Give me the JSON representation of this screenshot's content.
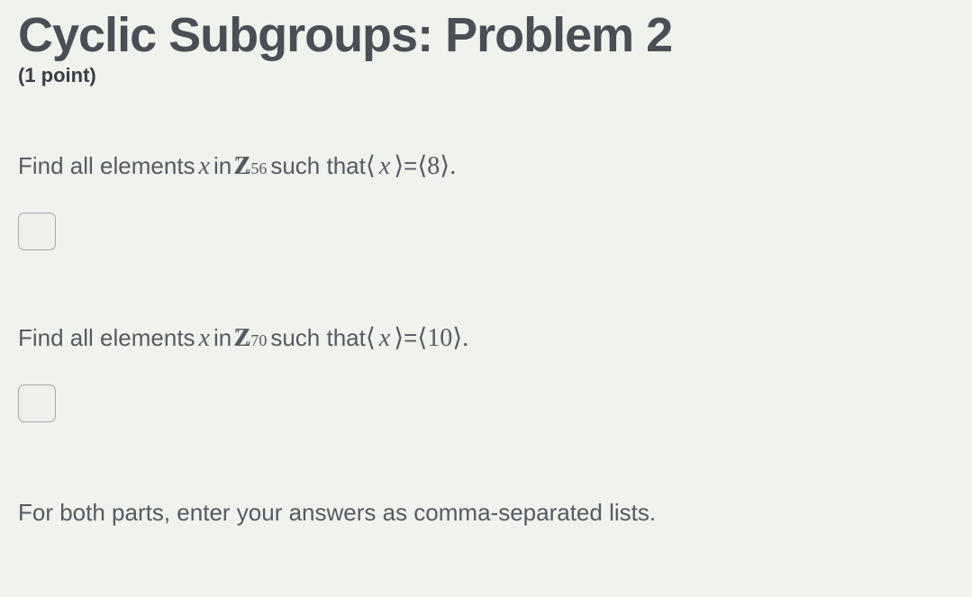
{
  "header": {
    "title": "Cyclic Subgroups: Problem 2",
    "points": "(1 point)"
  },
  "question1": {
    "prefix": "Find all elements ",
    "var": "x",
    "mid": " in ",
    "group_symbol": "Z",
    "group_sub": "56",
    "suffix1": " such that ",
    "angle_open": "⟨",
    "angle_var": "x",
    "angle_close": "⟩",
    "equals": " = ",
    "gen_open": "⟨",
    "gen_val": "8",
    "gen_close": "⟩.",
    "input_value": ""
  },
  "question2": {
    "prefix": "Find all elements ",
    "var": "x",
    "mid": " in ",
    "group_symbol": "Z",
    "group_sub": "70",
    "suffix1": " such that ",
    "angle_open": "⟨",
    "angle_var": "x",
    "angle_close": "⟩",
    "equals": " = ",
    "gen_open": "⟨",
    "gen_val": "10",
    "gen_close": "⟩.",
    "input_value": ""
  },
  "footer": {
    "note": "For both parts, enter your answers as comma-separated lists."
  }
}
